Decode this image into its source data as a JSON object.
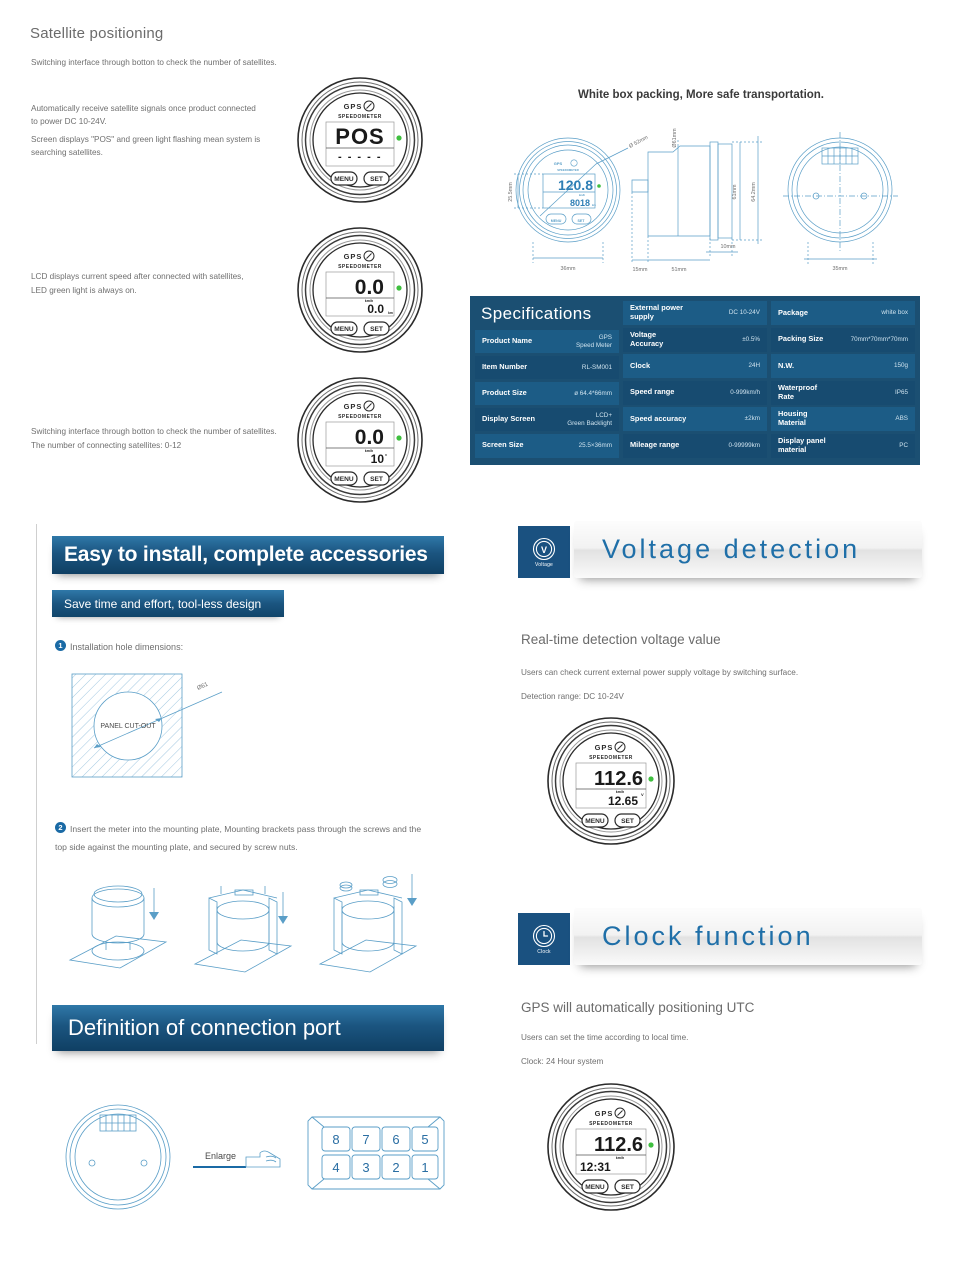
{
  "satellite": {
    "title": "Satellite positioning",
    "note_top": "Switching interface through botton to check the number of satellites.",
    "para1": "Automatically receive satellite signals once product connected to power  DC 10-24V.",
    "para2": "Screen displays \"POS\" and green light flashing mean system is searching satellites.",
    "para3": "LCD displays current speed after connected with satellites,",
    "para4": "LED green light is always on.",
    "para5": "Switching interface through botton to check the number of satellites.",
    "para6": "The number of connecting satellites: 0-12",
    "gauge1": {
      "brand": "GPS",
      "sub": "SPEEDOMETER",
      "main": "POS",
      "unit": "",
      "secondary": "- - - - -",
      "btn_left": "MENU",
      "btn_right": "SET"
    },
    "gauge2": {
      "brand": "GPS",
      "sub": "SPEEDOMETER",
      "main": "0.0",
      "unit": "km/h",
      "secondary": "0.0",
      "sec_unit": "km",
      "btn_left": "MENU",
      "btn_right": "SET"
    },
    "gauge3": {
      "brand": "GPS",
      "sub": "SPEEDOMETER",
      "main": "0.0",
      "unit": "km/h",
      "secondary": "10",
      "sec_unit": "°",
      "btn_left": "MENU",
      "btn_right": "SET"
    }
  },
  "packing": {
    "title": "White box packing, More safe transportation.",
    "gauge": {
      "brand": "GPS",
      "sub": "SPEEDOMETER",
      "main": "120.8",
      "unit": "km/h",
      "secondary": "8018",
      "sec_unit": "km"
    },
    "dims": {
      "front_width": "36mm",
      "front_height": "25.5mm",
      "front_diameter": "Ø 52mm",
      "side_inner_dia": "Ø61mm",
      "side_h1": "61mm",
      "side_h2": "64.2mm",
      "side_w1": "15mm",
      "side_w2": "51mm",
      "side_w3": "10mm",
      "back_width": "35mm"
    }
  },
  "specs": {
    "title": "Specifications",
    "col1": [
      {
        "k": "Product Name",
        "v": "GPS\nSpeed Meter"
      },
      {
        "k": "Item Number",
        "v": "RL-SM001"
      },
      {
        "k": "Product Size",
        "v": "ø 64.4*66mm"
      },
      {
        "k": "Display Screen",
        "v": "LCD+\nGreen Backlight"
      },
      {
        "k": "Screen Size",
        "v": "25.5×36mm"
      }
    ],
    "col2": [
      {
        "k": "External power\nsupply",
        "v": "DC 10-24V"
      },
      {
        "k": "Voltage\nAccuracy",
        "v": "±0.5%"
      },
      {
        "k": "Clock",
        "v": "24H"
      },
      {
        "k": "Speed range",
        "v": "0-999km/h"
      },
      {
        "k": "Speed accuracy",
        "v": "±2km"
      },
      {
        "k": "Mileage range",
        "v": "0-99999km"
      }
    ],
    "col3": [
      {
        "k": "Package",
        "v": "white box"
      },
      {
        "k": "Packing Size",
        "v": "70mm*70mm*70mm"
      },
      {
        "k": "N.W.",
        "v": "150g"
      },
      {
        "k": "Waterproof\nRate",
        "v": "IP65"
      },
      {
        "k": "Housing\nMaterial",
        "v": "ABS"
      },
      {
        "k": "Display panel\nmaterial",
        "v": "PC"
      }
    ]
  },
  "install": {
    "banner": "Easy to install, complete accessories",
    "subbanner": "Save time and effort, tool-less design",
    "step1": "Installation hole dimensions:",
    "step1_num": "1",
    "step2_num": "2",
    "step2": "Insert the meter into the mounting plate, Mounting brackets pass through the screws and the top side against the mounting plate, and secured by screw nuts.",
    "cutout_label": "PANEL CUT-OUT",
    "cutout_dim": "Ø61"
  },
  "connection": {
    "banner": "Definition of connection port",
    "enlarge": "Enlarge",
    "pins_top": [
      "8",
      "7",
      "6",
      "5"
    ],
    "pins_bottom": [
      "4",
      "3",
      "2",
      "1"
    ]
  },
  "voltage": {
    "icon_letter": "V",
    "icon_caption": "Voltage",
    "banner": "Voltage detection",
    "heading": "Real-time detection voltage value",
    "line1": "Users can check current external power supply voltage by switching surface.",
    "line2": "Detection range: DC 10-24V",
    "gauge": {
      "brand": "GPS",
      "sub": "SPEEDOMETER",
      "main": "112.6",
      "unit": "km/h",
      "secondary": "12.65",
      "sec_unit": "V",
      "btn_left": "MENU",
      "btn_right": "SET"
    }
  },
  "clock": {
    "icon_caption": "Clock",
    "banner": "Clock function",
    "heading": "GPS will automatically positioning UTC",
    "line1": "Users can set the time according to local time.",
    "line2": "Clock: 24 Hour system",
    "gauge": {
      "brand": "GPS",
      "sub": "SPEEDOMETER",
      "main": "112.6",
      "unit": "km/h",
      "secondary": "12:31",
      "sec_unit": "",
      "btn_left": "MENU",
      "btn_right": "SET"
    }
  },
  "colors": {
    "brand_blue": "#1b5580",
    "accent_blue": "#1f6fa8",
    "tech_line": "#5a9ec7",
    "led_green": "#3fbf3f"
  }
}
